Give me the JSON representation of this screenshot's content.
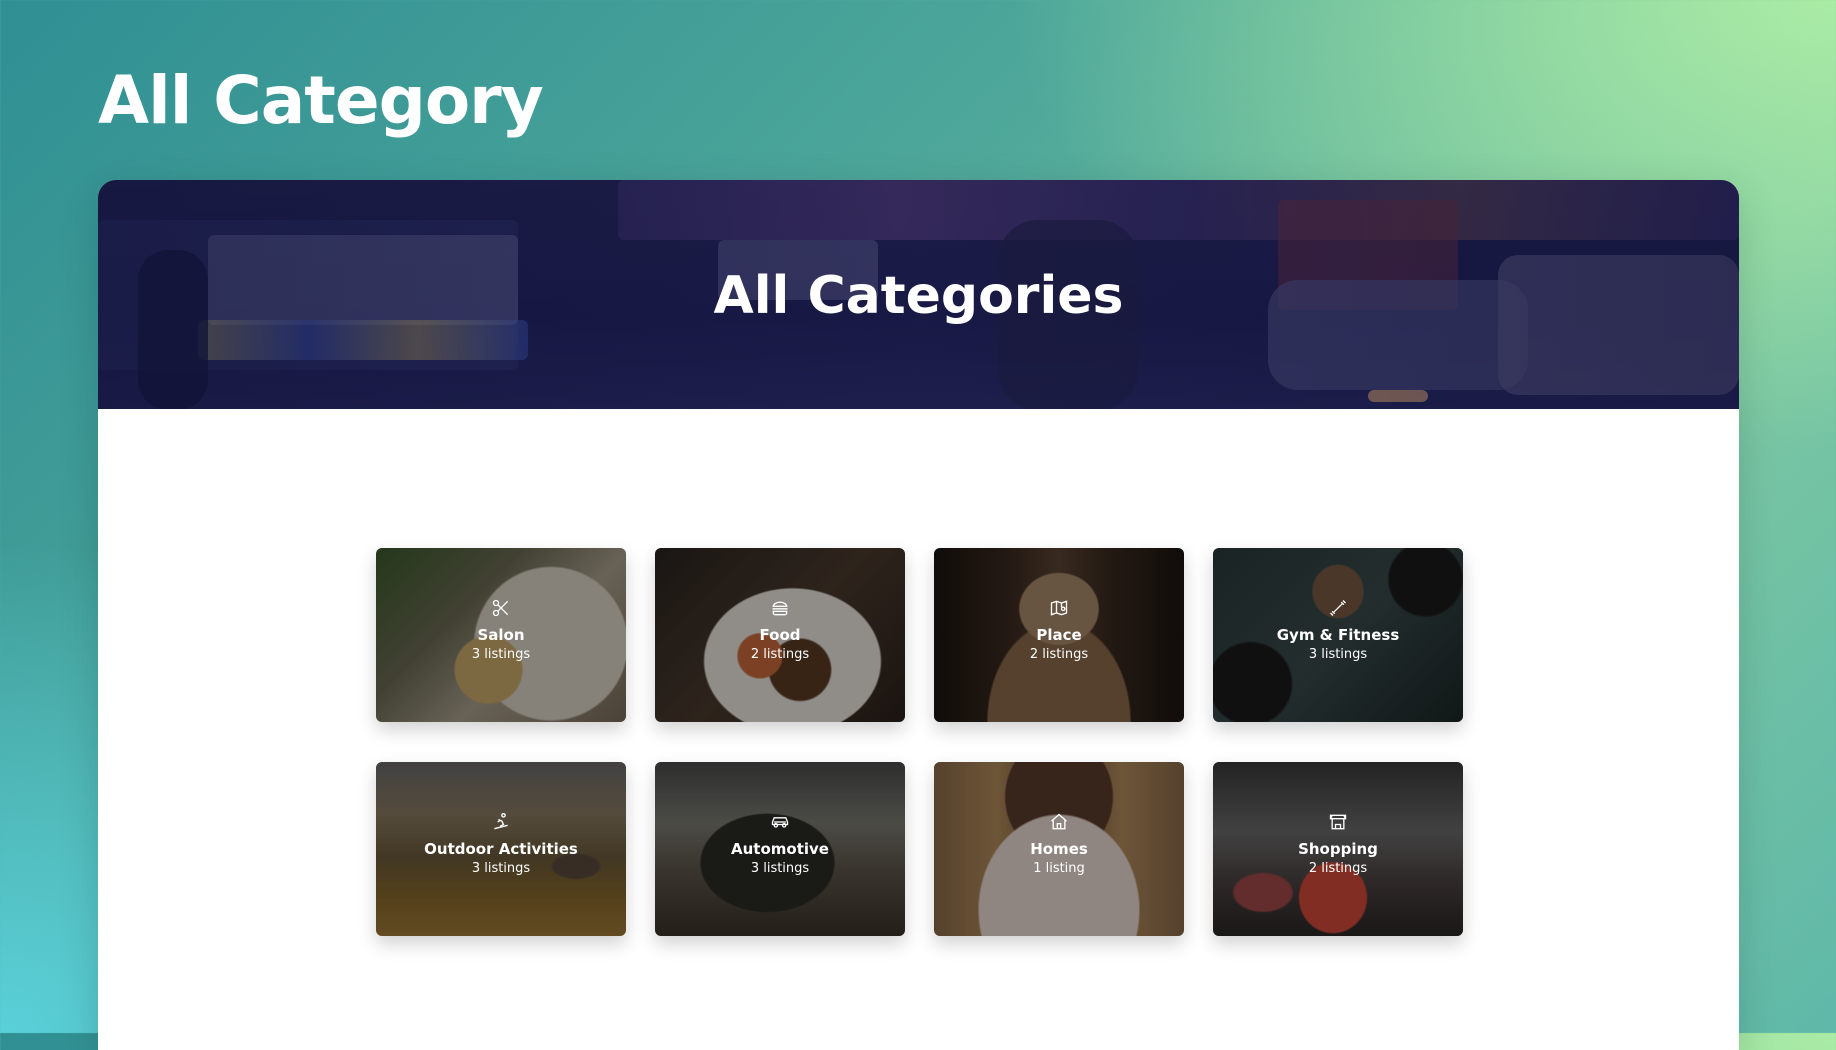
{
  "page": {
    "heading": "All Category"
  },
  "hero": {
    "title": "All Categories"
  },
  "categories": [
    {
      "name": "Salon",
      "count": "3 listings",
      "icon": "scissors-icon"
    },
    {
      "name": "Food",
      "count": "2 listings",
      "icon": "burger-icon"
    },
    {
      "name": "Place",
      "count": "2 listings",
      "icon": "map-pin-icon"
    },
    {
      "name": "Gym & Fitness",
      "count": "3 listings",
      "icon": "dumbbell-icon"
    },
    {
      "name": "Outdoor Activities",
      "count": "3 listings",
      "icon": "ski-icon"
    },
    {
      "name": "Automotive",
      "count": "3 listings",
      "icon": "car-icon"
    },
    {
      "name": "Homes",
      "count": "1 listing",
      "icon": "home-icon"
    },
    {
      "name": "Shopping",
      "count": "2 listings",
      "icon": "store-icon"
    }
  ]
}
